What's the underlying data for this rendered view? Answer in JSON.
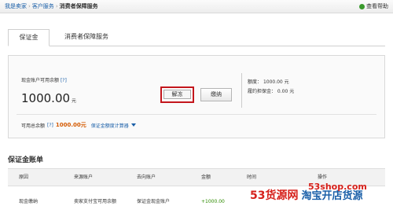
{
  "breadcrumb": {
    "home": "我是卖家",
    "service": "客户服务",
    "current": "消费者保障服务",
    "sep": "›"
  },
  "help": {
    "label": "查看帮助"
  },
  "tabs": [
    {
      "label": "保证金"
    },
    {
      "label": "消费者保障服务"
    }
  ],
  "account": {
    "cash_label": "现金账户可用余额",
    "help_mark": "[?]",
    "balance": "1000.00",
    "currency": "元",
    "unfreeze_label": "解冻",
    "pay_label": "缴纳",
    "limit_label": "额度：",
    "limit_value": "1000.00 元",
    "frozen_label": "履约担保金",
    "frozen_value": "：  0.00 元",
    "total_label": "可用总余额",
    "total_value": "1000.00元",
    "calc_label": "保证金额度计算器"
  },
  "ledger": {
    "title": "保证金账单",
    "columns": [
      "原因",
      "来源账户",
      "去向账户",
      "金额",
      "时间",
      "操作"
    ],
    "rows": [
      {
        "reason": "现金缴纳",
        "from": "卖家支付宝可用余额",
        "to": "保证金现金账户",
        "amount": "+1000.00"
      }
    ]
  },
  "watermark": {
    "a": "53货源网",
    "b": "淘宝开店货源",
    "c": "53shop.com"
  }
}
